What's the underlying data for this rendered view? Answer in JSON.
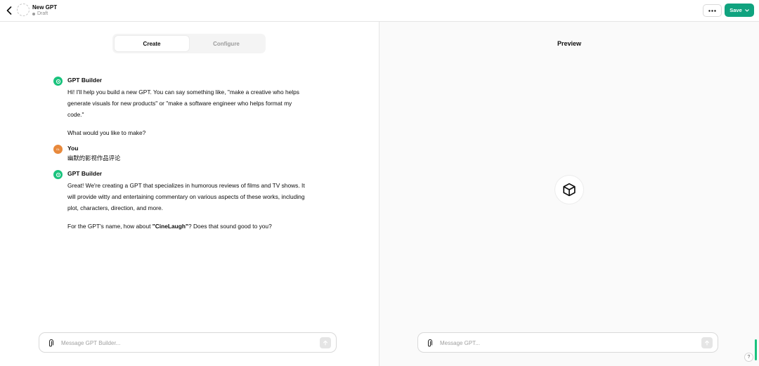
{
  "header": {
    "gpt_name": "New GPT",
    "status": "Draft",
    "more_icon": "ellipsis-icon",
    "save_label": "Save",
    "accent_color": "#10a37f"
  },
  "tabs": [
    {
      "label": "Create",
      "active": true
    },
    {
      "label": "Configure",
      "active": false
    }
  ],
  "conversation": [
    {
      "author": "GPT Builder",
      "role": "builder",
      "lines": [
        "Hi! I'll help you build a new GPT. You can say something like, \"make a creative who helps",
        "generate visuals for new products\" or \"make a software engineer who helps format my",
        "code.\""
      ],
      "followup": "What would you like to make?"
    },
    {
      "author": "You",
      "role": "user",
      "avatar_text": "GL",
      "text": "幽默的影视作品评论"
    },
    {
      "author": "GPT Builder",
      "role": "builder",
      "lines": [
        "Great! We're creating a GPT that specializes in humorous reviews of films and TV shows. It",
        "will provide witty and entertaining commentary on various aspects of these works, including",
        "plot, characters, direction, and more."
      ],
      "followup_pre": "For the GPT's name, how about ",
      "followup_bold": "\"CineLaugh\"",
      "followup_post": "? Does that sound good to you?"
    }
  ],
  "builder_input": {
    "placeholder": "Message GPT Builder..."
  },
  "preview": {
    "title": "Preview",
    "logo_icon": "cube-icon",
    "input": {
      "placeholder": "Message GPT..."
    }
  },
  "help_label": "?"
}
